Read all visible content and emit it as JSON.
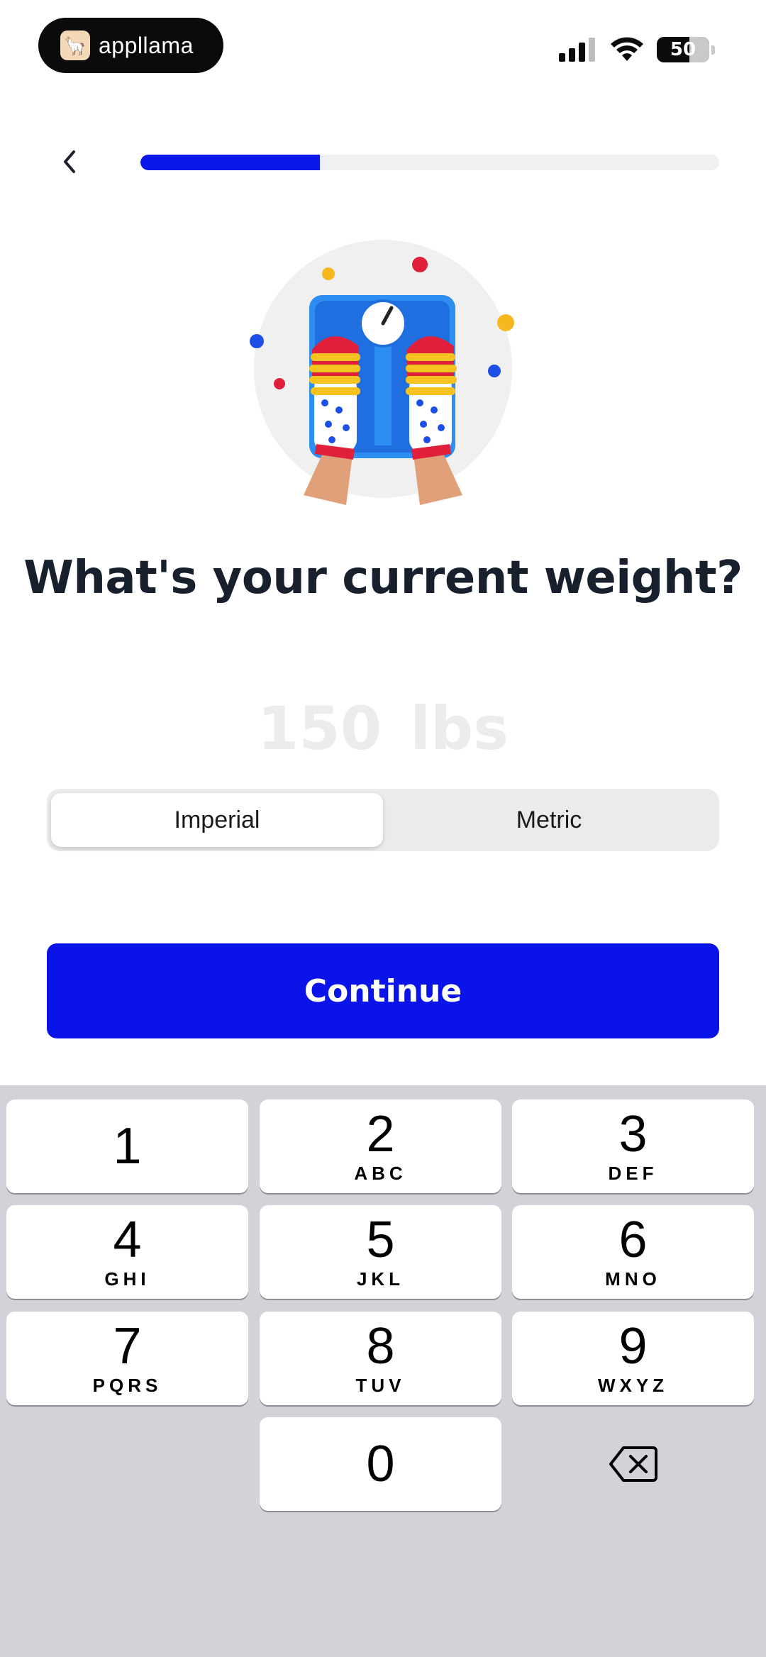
{
  "status_bar": {
    "brand": "appllama",
    "battery": "50"
  },
  "header": {
    "progress_percent": 31
  },
  "question": "What's your current weight?",
  "weight": {
    "value": "150",
    "unit": "lbs"
  },
  "unit_toggle": {
    "options": [
      "Imperial",
      "Metric"
    ],
    "selected": "Imperial"
  },
  "continue_label": "Continue",
  "keypad": {
    "keys": [
      {
        "num": "1",
        "letters": ""
      },
      {
        "num": "2",
        "letters": "ABC"
      },
      {
        "num": "3",
        "letters": "DEF"
      },
      {
        "num": "4",
        "letters": "GHI"
      },
      {
        "num": "5",
        "letters": "JKL"
      },
      {
        "num": "6",
        "letters": "MNO"
      },
      {
        "num": "7",
        "letters": "PQRS"
      },
      {
        "num": "8",
        "letters": "TUV"
      },
      {
        "num": "9",
        "letters": "WXYZ"
      },
      {
        "num": "0",
        "letters": ""
      }
    ],
    "delete_icon": "backspace-icon"
  },
  "colors": {
    "accent": "#0a14e8",
    "progress_track": "#eff0f2",
    "keypad_bg": "#d1d3d9"
  }
}
